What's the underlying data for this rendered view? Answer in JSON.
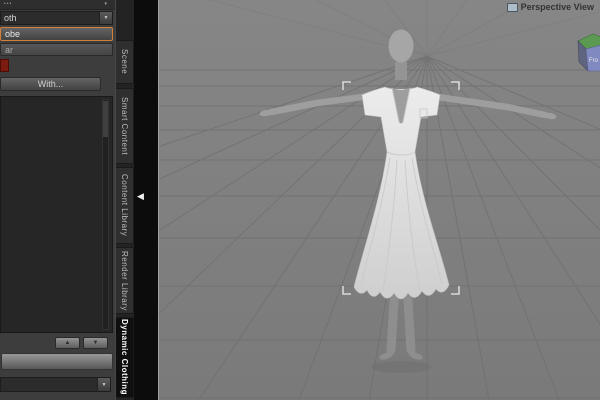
{
  "icons": {
    "grip_dots": "•••",
    "header_menu_arrow": "▾",
    "combo_arrow": "▼",
    "spin_up": "▲",
    "spin_down": "▼",
    "collapse_left": "◀"
  },
  "left_panel": {
    "cloth_dropdown": {
      "value": "oth"
    },
    "focused_button": {
      "label": "obe"
    },
    "flat_button": {
      "label": "ar"
    },
    "drape_with_button": {
      "label": "With..."
    },
    "bottom_dropdown": {
      "value": ""
    }
  },
  "side_tabs": {
    "items": [
      {
        "label": "Scene"
      },
      {
        "label": "Smart Content"
      },
      {
        "label": "Content Library"
      },
      {
        "label": "Render Library"
      },
      {
        "label": "Dynamic Clothing"
      }
    ],
    "active": "Dynamic Clothing"
  },
  "viewport": {
    "label": "Perspective View",
    "cube_front_label": "Fro",
    "colors": {
      "background": "#7f7f7f",
      "grid": "#6d6d6d",
      "skin": "#9e9e9e",
      "dress_light": "#ececec",
      "dress_dark": "#cfcfcf",
      "selection": "#ebebeb",
      "cube_top": "#5c9a52",
      "cube_front": "#8089c0",
      "accent_orange": "#d5803a"
    }
  }
}
